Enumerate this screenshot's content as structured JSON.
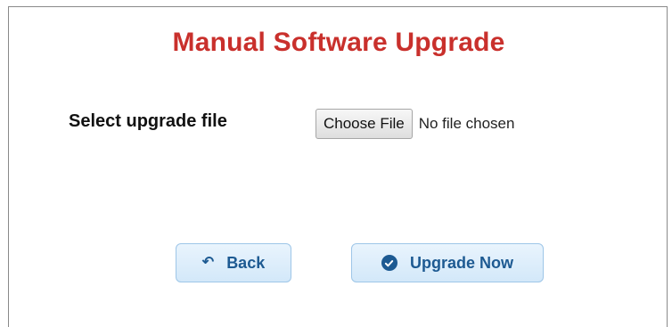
{
  "page": {
    "title": "Manual Software Upgrade"
  },
  "upload": {
    "label": "Select upgrade file",
    "choose_button_label": "Choose File",
    "status_text": "No file chosen"
  },
  "actions": {
    "back_label": "Back",
    "back_icon": "back-arrow-icon",
    "upgrade_label": "Upgrade Now",
    "upgrade_icon": "check-circle-icon"
  },
  "colors": {
    "title": "#c9302c",
    "button_text": "#1d5a92",
    "button_bg": "#d3e8f9"
  }
}
